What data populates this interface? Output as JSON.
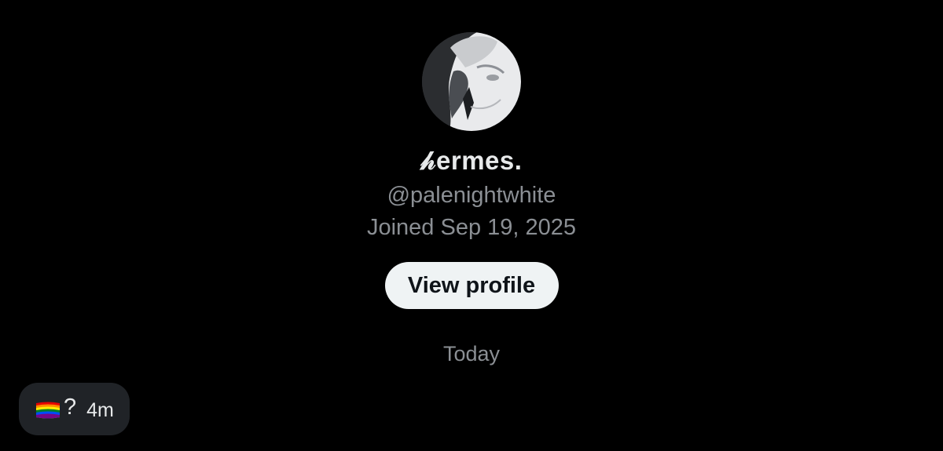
{
  "profile": {
    "display_name": "𝒽ermes.",
    "handle": "@palenightwhite",
    "joined": "Joined Sep 19, 2025",
    "view_profile_label": "View profile",
    "avatar_icon": "anime-character-avatar"
  },
  "conversation": {
    "date_separator": "Today",
    "messages": [
      {
        "flag_icon": "rainbow-flag-icon",
        "text": "?",
        "time": "4m"
      }
    ]
  },
  "colors": {
    "background": "#000000",
    "primary_text": "#e7e9ea",
    "secondary_text": "#8b8f94",
    "button_bg": "#eff3f4",
    "bubble_bg": "#202327"
  }
}
